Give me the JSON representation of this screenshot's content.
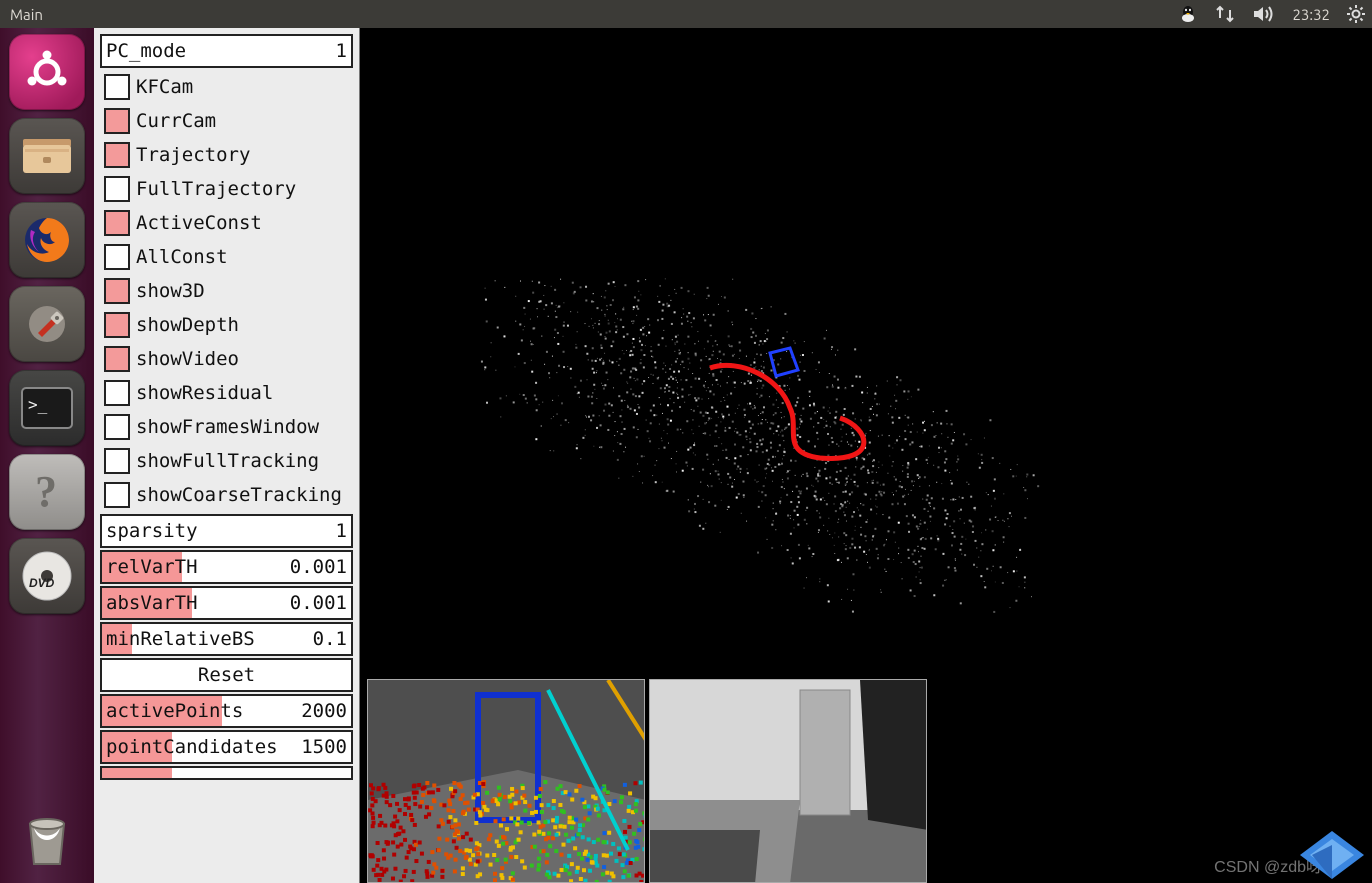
{
  "menubar": {
    "title": "Main",
    "clock": "23:32"
  },
  "panel": {
    "pc_mode": {
      "label": "PC_mode",
      "value": "1"
    },
    "checks": [
      {
        "key": "kfcam",
        "label": "KFCam",
        "checked": false
      },
      {
        "key": "currcam",
        "label": "CurrCam",
        "checked": true
      },
      {
        "key": "trajectory",
        "label": "Trajectory",
        "checked": true
      },
      {
        "key": "fulltrajectory",
        "label": "FullTrajectory",
        "checked": false
      },
      {
        "key": "activeconst",
        "label": "ActiveConst",
        "checked": true
      },
      {
        "key": "allconst",
        "label": "AllConst",
        "checked": false
      },
      {
        "key": "show3d",
        "label": "show3D",
        "checked": true
      },
      {
        "key": "showdepth",
        "label": "showDepth",
        "checked": true
      },
      {
        "key": "showvideo",
        "label": "showVideo",
        "checked": true
      },
      {
        "key": "showresidual",
        "label": "showResidual",
        "checked": false
      },
      {
        "key": "showframeswindow",
        "label": "showFramesWindow",
        "checked": false
      },
      {
        "key": "showfulltracking",
        "label": "showFullTracking",
        "checked": false
      },
      {
        "key": "showcoarsetracking",
        "label": "showCoarseTracking",
        "checked": false
      }
    ],
    "sparsity": {
      "label": "sparsity",
      "value": "1",
      "fill_pct": 0
    },
    "relvarth": {
      "label": "relVarTH",
      "value": "0.001",
      "fill_pct": 32
    },
    "absvarth": {
      "label": "absVarTH",
      "value": "0.001",
      "fill_pct": 36
    },
    "minrelativebs": {
      "label": "minRelativeBS",
      "value": "0.1",
      "fill_pct": 12
    },
    "reset_label": "Reset",
    "activepoints": {
      "label": "activePoints",
      "value": "2000",
      "fill_pct": 48
    },
    "pointcandidates": {
      "label": "pointCandidates",
      "value": "1500",
      "fill_pct": 28
    }
  },
  "watermark": "CSDN @zdb呀"
}
